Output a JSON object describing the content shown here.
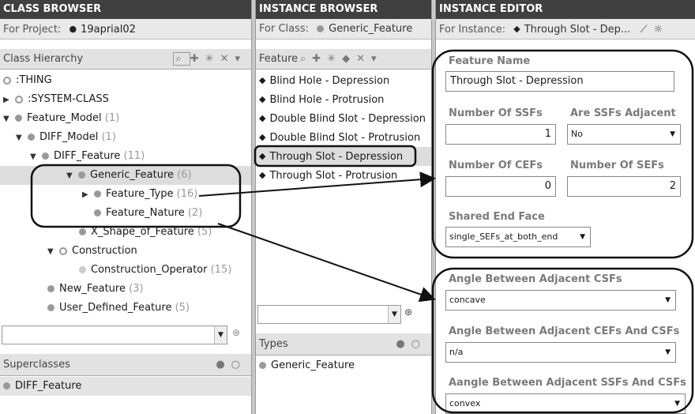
{
  "class_browser": {
    "title": "CLASS BROWSER",
    "project_label": "For Project:",
    "project_name": "19aprial02",
    "hierarchy_label": "Class Hierarchy",
    "tree": [
      {
        "label": ":THING",
        "count": ""
      },
      {
        "label": ":SYSTEM-CLASS",
        "count": ""
      },
      {
        "label": "Feature_Model",
        "count": "(1)"
      },
      {
        "label": "DIFF_Model",
        "count": "(1)"
      },
      {
        "label": "DIFF_Feature",
        "count": "(11)"
      },
      {
        "label": "Generic_Feature",
        "count": "(6)"
      },
      {
        "label": "Feature_Type",
        "count": "(16)"
      },
      {
        "label": "Feature_Nature",
        "count": "(2)"
      },
      {
        "label": "X_Shape_of_Feature",
        "count": "(5)"
      },
      {
        "label": "Construction",
        "count": ""
      },
      {
        "label": "Construction_Operator",
        "count": "(15)"
      },
      {
        "label": "New_Feature",
        "count": "(3)"
      },
      {
        "label": "User_Defined_Feature",
        "count": "(5)"
      }
    ],
    "superclasses_label": "Superclasses",
    "superclasses": [
      "DIFF_Feature"
    ]
  },
  "instance_browser": {
    "title": "INSTANCE BROWSER",
    "class_label": "For Class:",
    "class_name": "Generic_Feature",
    "list_label": "Feature",
    "instances": [
      "Blind Hole - Depression",
      "Blind Hole - Protrusion",
      "Double Blind Slot - Depression",
      "Double Blind Slot - Protrusion",
      "Through Slot - Depression",
      "Through Slot - Protrusion"
    ],
    "types_label": "Types",
    "types": [
      "Generic_Feature"
    ]
  },
  "instance_editor": {
    "title": "INSTANCE EDITOR",
    "instance_label": "For Instance:",
    "instance_name": "Through Slot - Dep...",
    "feature_name_label": "Feature Name",
    "feature_name_value": "Through Slot - Depression",
    "num_ssfs_label": "Number Of SSFs",
    "num_ssfs_value": "1",
    "ssfs_adjacent_label": "Are SSFs Adjacent",
    "ssfs_adjacent_value": "No",
    "num_cefs_label": "Number Of CEFs",
    "num_cefs_value": "0",
    "num_sefs_label": "Number Of SEFs",
    "num_sefs_value": "2",
    "shared_end_face_label": "Shared End Face",
    "shared_end_face_value": "single_SEFs_at_both_end",
    "angle_csfs_label": "Angle Between Adjacent CSFs",
    "angle_csfs_value": "concave",
    "angle_cefs_csfs_label": "Angle Between Adjacent CEFs And CSFs",
    "angle_cefs_csfs_value": "n/a",
    "angle_ssfs_csfs_label": "Aangle Between Adjacent SSFs And CSFs",
    "angle_ssfs_csfs_value": "convex"
  },
  "icons": {
    "search": "⌕",
    "add": "✚",
    "remove": "✕",
    "menu": "▾",
    "binoculars": "⊛"
  }
}
